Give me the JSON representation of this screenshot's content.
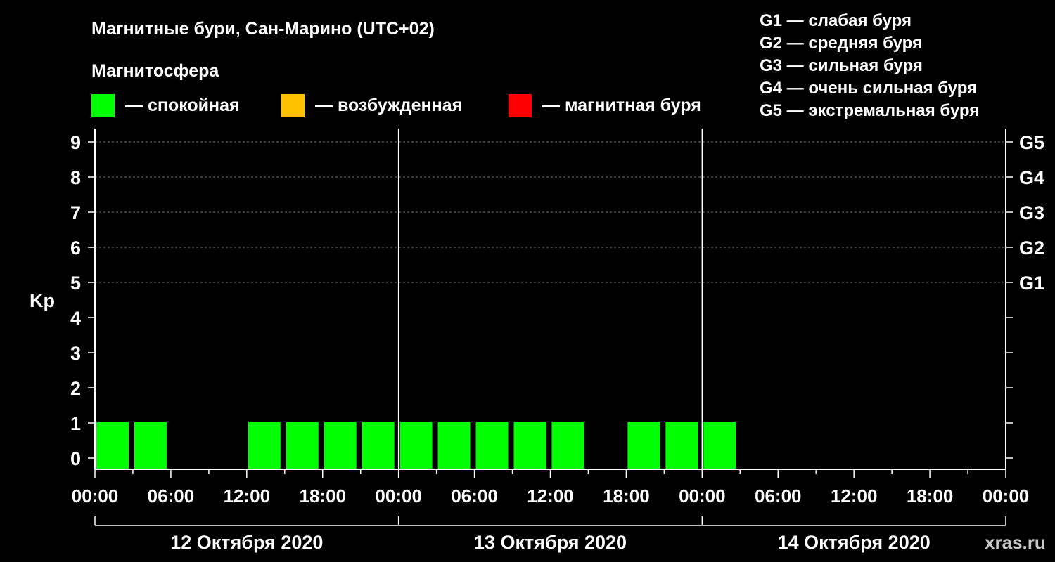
{
  "chart_data": {
    "type": "bar",
    "title": "Магнитные бури, Сан-Марино (UTC+02)",
    "legend": {
      "title": "Магнитосфера",
      "items": [
        {
          "label": "— спокойная",
          "color": "#00ff00"
        },
        {
          "label": "— возбужденная",
          "color": "#ffc000"
        },
        {
          "label": "— магнитная буря",
          "color": "#ff0000"
        }
      ]
    },
    "g_scale": [
      "G1 — слабая буря",
      "G2 — средняя буря",
      "G3 — сильная буря",
      "G4 — очень сильная буря",
      "G5 — экстремальная буря"
    ],
    "ylabel": "Kp",
    "ylim": [
      0,
      9
    ],
    "y_ticks": [
      "0",
      "1",
      "2",
      "3",
      "4",
      "5",
      "6",
      "7",
      "8",
      "9"
    ],
    "right_axis": [
      {
        "label": "G1",
        "kp": 5
      },
      {
        "label": "G2",
        "kp": 6
      },
      {
        "label": "G3",
        "kp": 7
      },
      {
        "label": "G4",
        "kp": 8
      },
      {
        "label": "G5",
        "kp": 9
      }
    ],
    "grid": "horizontal dashed at Kp 5–9",
    "xlim_hours": [
      0,
      72
    ],
    "x_tick_labels": [
      "00:00",
      "06:00",
      "12:00",
      "18:00",
      "00:00",
      "06:00",
      "12:00",
      "18:00",
      "00:00",
      "06:00",
      "12:00",
      "18:00",
      "00:00"
    ],
    "days": [
      "12 Октября 2020",
      "13 Октября 2020",
      "14 Октября 2020"
    ],
    "series": [
      {
        "bar_hours": 3,
        "values": [
          1,
          1,
          null,
          null,
          1,
          1,
          1,
          1,
          1,
          1,
          1,
          1,
          1,
          null,
          1,
          1,
          1,
          null,
          null,
          null,
          null,
          null,
          null,
          null
        ],
        "colors": [
          "#00ff00",
          "#00ff00",
          null,
          null,
          "#00ff00",
          "#00ff00",
          "#00ff00",
          "#00ff00",
          "#00ff00",
          "#00ff00",
          "#00ff00",
          "#00ff00",
          "#00ff00",
          null,
          "#00ff00",
          "#00ff00",
          "#00ff00",
          null,
          null,
          null,
          null,
          null,
          null,
          null
        ]
      }
    ]
  },
  "watermark": "xras.ru"
}
